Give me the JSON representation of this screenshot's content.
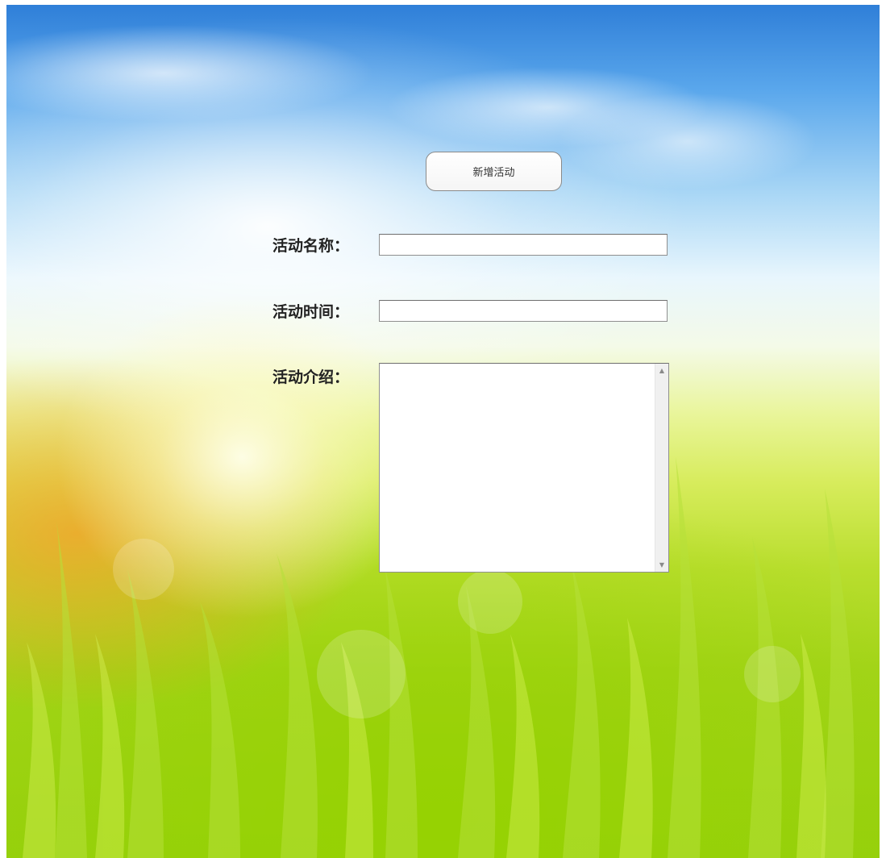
{
  "form": {
    "add_button_label": "新增活动",
    "name_label": "活动名称：",
    "name_value": "",
    "time_label": "活动时间：",
    "time_value": "",
    "intro_label": "活动介绍：",
    "intro_value": ""
  },
  "icons": {
    "scroll_up": "▲",
    "scroll_down": "▼"
  }
}
